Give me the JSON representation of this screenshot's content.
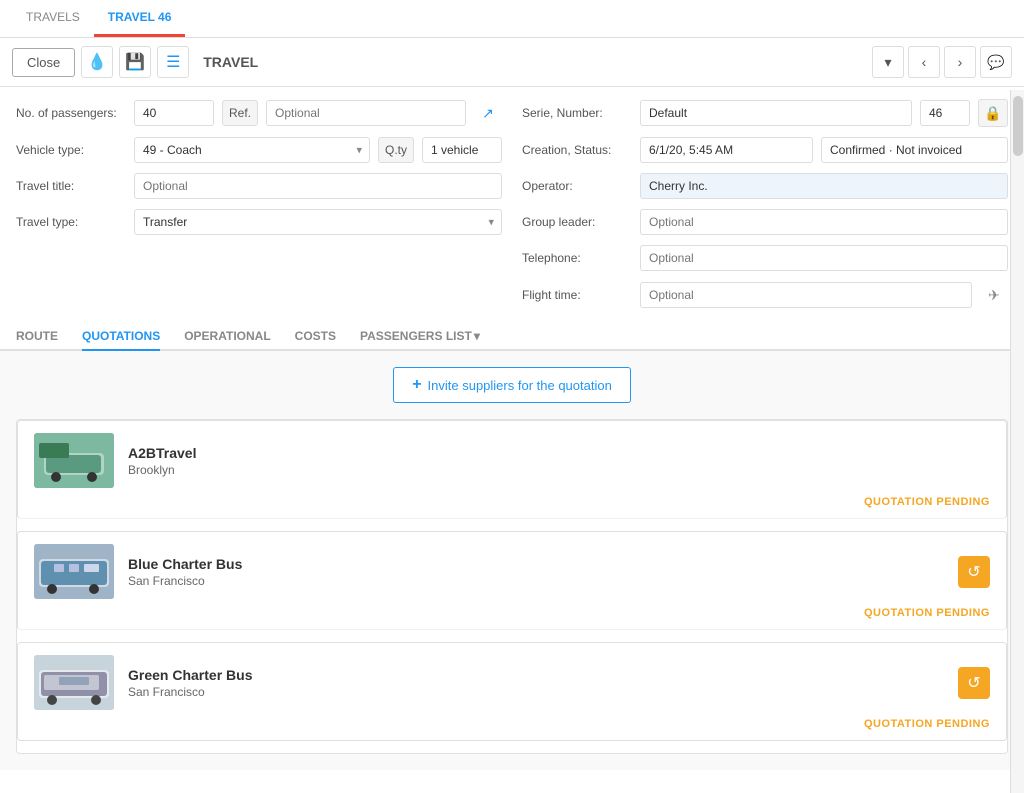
{
  "tabs": {
    "travels_label": "TRAVELS",
    "travel46_label": "TRAVEL 46"
  },
  "toolbar": {
    "close_label": "Close",
    "title": "TRAVEL",
    "dropdown_icon": "▾",
    "prev_icon": "‹",
    "next_icon": "›",
    "chat_icon": "💬"
  },
  "form": {
    "left": {
      "passengers_label": "No. of passengers:",
      "passengers_value": "40",
      "ref_label": "Ref.",
      "ref_placeholder": "Optional",
      "vehicle_type_label": "Vehicle type:",
      "vehicle_type_value": "49 - Coach",
      "qty_label": "Q.ty",
      "qty_value": "1 vehicle",
      "travel_title_label": "Travel title:",
      "travel_title_placeholder": "Optional",
      "travel_type_label": "Travel type:",
      "travel_type_value": "Transfer"
    },
    "right": {
      "serie_number_label": "Serie, Number:",
      "serie_value": "Default",
      "number_value": "46",
      "creation_status_label": "Creation, Status:",
      "creation_value": "6/1/20, 5:45 AM",
      "status_value": "Confirmed · Not invoiced",
      "operator_label": "Operator:",
      "operator_value": "Cherry Inc.",
      "group_leader_label": "Group leader:",
      "group_leader_placeholder": "Optional",
      "telephone_label": "Telephone:",
      "telephone_placeholder": "Optional",
      "flight_time_label": "Flight time:",
      "flight_time_placeholder": "Optional"
    }
  },
  "subtabs": {
    "route": "ROUTE",
    "quotations": "QUOTATIONS",
    "operational": "OPERATIONAL",
    "costs": "COSTS",
    "passengers_list": "PASSENGERS LIST"
  },
  "quotations": {
    "invite_label": "Invite suppliers for the quotation",
    "suppliers": [
      {
        "name": "A2BTravel",
        "location": "Brooklyn",
        "status": "QUOTATION PENDING",
        "has_action_icon": false
      },
      {
        "name": "Blue Charter Bus",
        "location": "San Francisco",
        "status": "QUOTATION PENDING",
        "has_action_icon": true
      },
      {
        "name": "Green Charter Bus",
        "location": "San Francisco",
        "status": "QUOTATION PENDING",
        "has_action_icon": true
      }
    ]
  }
}
